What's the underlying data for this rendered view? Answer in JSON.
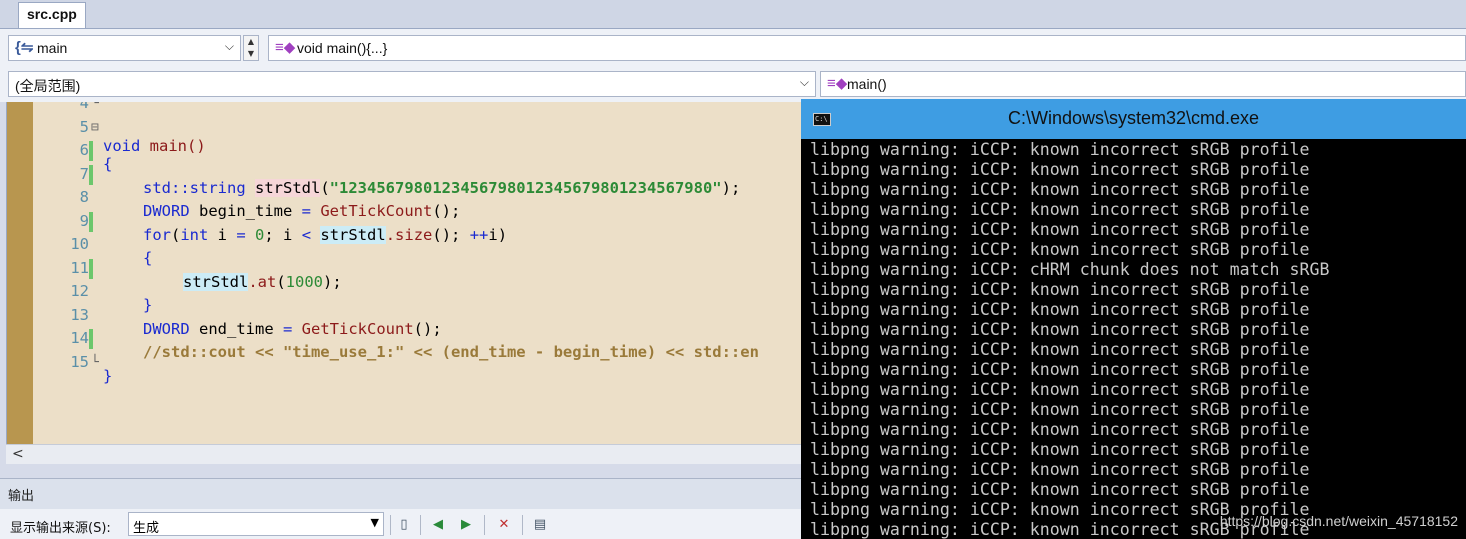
{
  "tab": {
    "label": "src.cpp"
  },
  "nav1": {
    "scope_value": "main",
    "member_value": "void main(){...}"
  },
  "nav2": {
    "project_value": "(全局范围)",
    "function_value": "main()"
  },
  "editor": {
    "lines": [
      {
        "num": "4",
        "fold": "└",
        "changed": false
      },
      {
        "num": "5",
        "fold": "⊟",
        "changed": false
      },
      {
        "num": "6",
        "fold": "",
        "changed": true
      },
      {
        "num": "7",
        "fold": "",
        "changed": true
      },
      {
        "num": "8",
        "fold": "",
        "changed": false
      },
      {
        "num": "9",
        "fold": "",
        "changed": true
      },
      {
        "num": "10",
        "fold": "",
        "changed": false
      },
      {
        "num": "11",
        "fold": "",
        "changed": true
      },
      {
        "num": "12",
        "fold": "",
        "changed": false
      },
      {
        "num": "13",
        "fold": "",
        "changed": false
      },
      {
        "num": "14",
        "fold": "",
        "changed": true
      },
      {
        "num": "15",
        "fold": "└",
        "changed": false
      }
    ],
    "code": {
      "l5_kw": "void",
      "l5_fn": "main()",
      "l6": "{",
      "l7_type": "std::string",
      "l7_var": "strStdl",
      "l7_paren": "(",
      "l7_str": "\"1234567980123456798012345679801234567980\"",
      "l7_end": ");",
      "l8_type": "DWORD",
      "l8_var": " begin_time ",
      "l8_eq": "=",
      "l8_fn": " GetTickCount",
      "l8_end": "();",
      "l9_for": "for",
      "l9_a": "(",
      "l9_int": "int",
      "l9_b": " i ",
      "l9_eq": "=",
      "l9_zero": " 0",
      "l9_c": "; i ",
      "l9_lt": "<",
      "l9_sp": " ",
      "l9_var": "strStdl",
      "l9_size": ".size",
      "l9_d": "(); ",
      "l9_inc": "++",
      "l9_e": "i)",
      "l10": "{",
      "l11_var": "strStdl",
      "l11_at": ".at",
      "l11_a": "(",
      "l11_num": "1000",
      "l11_end": ");",
      "l12": "}",
      "l13_type": "DWORD",
      "l13_var": " end_time ",
      "l13_eq": "=",
      "l13_fn": " GetTickCount",
      "l13_end": "();",
      "l14": "//std::cout << \"time_use_1:\" << (end_time - begin_time) << std::en",
      "l15": "}"
    }
  },
  "output": {
    "title": "输出",
    "source_label": "显示输出来源(S):",
    "source_value": "生成"
  },
  "console": {
    "title": "C:\\Windows\\system32\\cmd.exe",
    "icon_text": "C:\\",
    "lines": [
      "libpng warning: iCCP: known incorrect sRGB profile",
      "libpng warning: iCCP: known incorrect sRGB profile",
      "libpng warning: iCCP: known incorrect sRGB profile",
      "libpng warning: iCCP: known incorrect sRGB profile",
      "libpng warning: iCCP: known incorrect sRGB profile",
      "libpng warning: iCCP: known incorrect sRGB profile",
      "libpng warning: iCCP: cHRM chunk does not match sRGB",
      "libpng warning: iCCP: known incorrect sRGB profile",
      "libpng warning: iCCP: known incorrect sRGB profile",
      "libpng warning: iCCP: known incorrect sRGB profile",
      "libpng warning: iCCP: known incorrect sRGB profile",
      "libpng warning: iCCP: known incorrect sRGB profile",
      "libpng warning: iCCP: known incorrect sRGB profile",
      "libpng warning: iCCP: known incorrect sRGB profile",
      "libpng warning: iCCP: known incorrect sRGB profile",
      "libpng warning: iCCP: known incorrect sRGB profile",
      "libpng warning: iCCP: known incorrect sRGB profile",
      "libpng warning: iCCP: known incorrect sRGB profile",
      "libpng warning: iCCP: known incorrect sRGB profile",
      "libpng warning: iCCP: known incorrect sRGB profile"
    ],
    "watermark": "https://blog.csdn.net/weixin_45718152"
  }
}
